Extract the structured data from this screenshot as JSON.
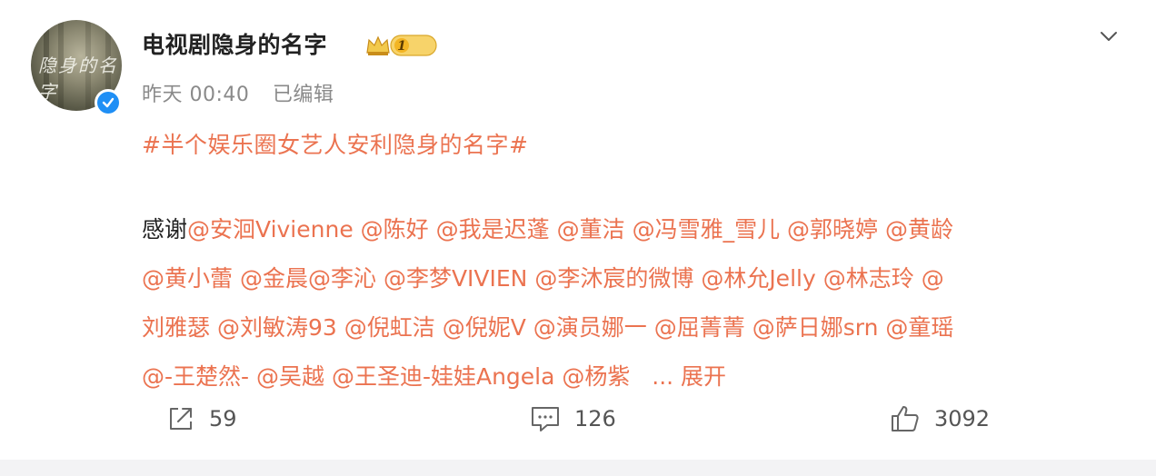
{
  "post": {
    "username": "电视剧隐身的名字",
    "badge_level": "1",
    "timestamp": "昨天 00:40",
    "edited_label": "已编辑",
    "hashtag": "#半个娱乐圈女艺人安利隐身的名字#",
    "thanks_prefix": "感谢",
    "lines": [
      [
        "@安洄Vivienne",
        "@陈好",
        "@我是迟蓬",
        "@董洁",
        "@冯雪雅_雪儿",
        "@郭晓婷",
        "@黄龄"
      ],
      [
        "@黄小蕾",
        "@金晨@李沁",
        "@李梦VIVIEN",
        "@李沐宸的微博",
        "@林允Jelly",
        "@林志玲",
        "@"
      ],
      [
        "刘雅瑟",
        "@刘敏涛93",
        "@倪虹洁",
        "@倪妮V",
        "@演员娜一",
        "@屈菁菁",
        "@萨日娜srn",
        "@童瑶"
      ],
      [
        "@-王楚然-",
        " @吴越",
        "@王圣迪-娃娃Angela",
        "@杨紫"
      ]
    ],
    "expand_label": "... 展开"
  },
  "avatar": {
    "overlay_text": "隐身的名字",
    "icon": "verified-badge-icon"
  },
  "actions": {
    "share_count": "59",
    "comment_count": "126",
    "like_count": "3092"
  },
  "colors": {
    "accent": "#eb7350",
    "text": "#222222",
    "muted": "#8a8a8a",
    "verified": "#1f8ff5"
  }
}
